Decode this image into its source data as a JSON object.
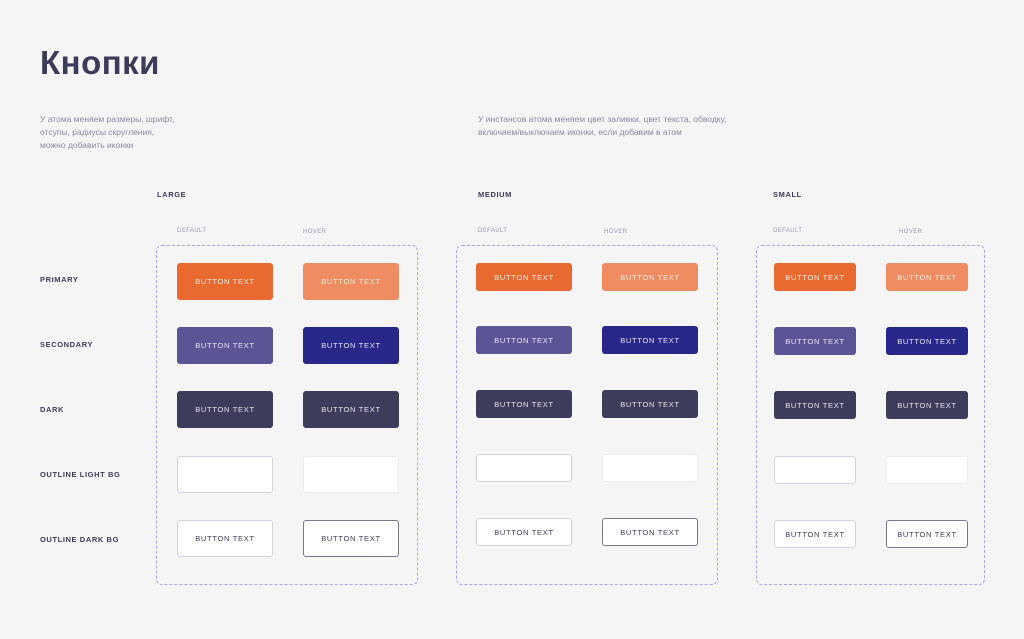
{
  "header": {
    "title": "Кнопки",
    "desc_atom": "У атома меняем размеры, шрифт, отсупы, радиусы скругления, можно добавить иконки",
    "desc_instance": "У инстансов атома меняем цвет заливки, цвет текста, обводку, включаем/выключаем иконки, если добавим в атом"
  },
  "sizes": {
    "large": "LARGE",
    "medium": "MEDIUM",
    "small": "SMALL"
  },
  "states": {
    "default": "DEFAULT",
    "hover": "HOVER"
  },
  "rows": {
    "primary": "PRIMARY",
    "secondary": "SECONDARY",
    "dark": "DARK",
    "outline_light": "OUTLINE LIGHT BG",
    "outline_dark": "OUTLINE DARK BG"
  },
  "button_label": "BUTTON TEXT",
  "colors": {
    "primary": "#e96a31",
    "primary_hover": "#ef8c62",
    "secondary": "#5b5595",
    "secondary_hover": "#28278a",
    "dark": "#3e3c5b",
    "panel_border": "#a9a2f2"
  }
}
